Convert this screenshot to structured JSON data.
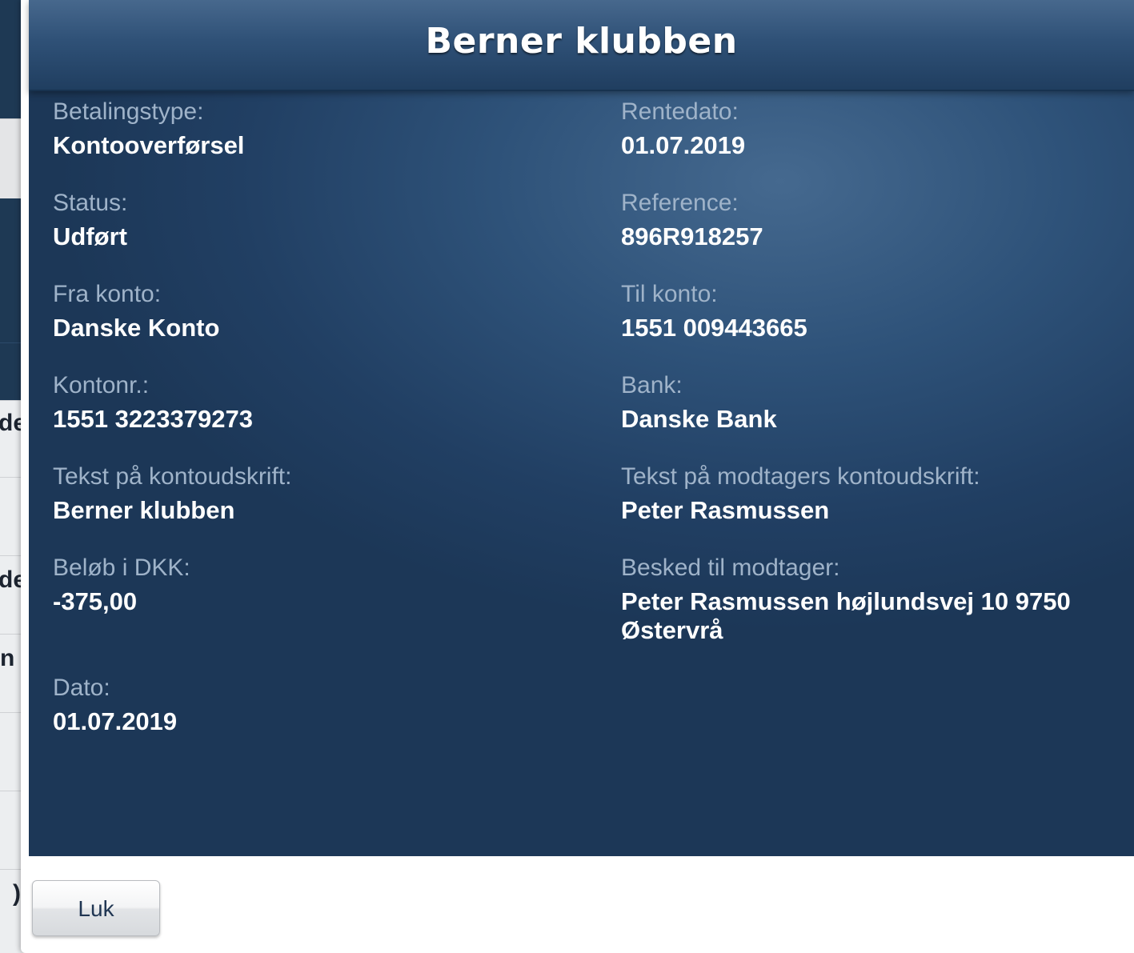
{
  "background": {
    "fragments": [
      "de",
      "de",
      "n",
      ")"
    ]
  },
  "modal": {
    "title": "Berner klubben",
    "left_fields": [
      {
        "label": "Betalingstype:",
        "value": "Kontooverførsel"
      },
      {
        "label": "Status:",
        "value": "Udført"
      },
      {
        "label": "Fra konto:",
        "value": "Danske Konto"
      },
      {
        "label": "Kontonr.:",
        "value": "1551 3223379273"
      },
      {
        "label": "Tekst på kontoudskrift:",
        "value": "Berner klubben"
      },
      {
        "label": "Beløb i DKK:",
        "value": "-375,00"
      },
      {
        "label": "Dato:",
        "value": "01.07.2019"
      }
    ],
    "right_fields": [
      {
        "label": "Rentedato:",
        "value": "01.07.2019"
      },
      {
        "label": "Reference:",
        "value": "896R918257"
      },
      {
        "label": "Til konto:",
        "value": "1551 009443665"
      },
      {
        "label": "Bank:",
        "value": "Danske Bank"
      },
      {
        "label": "Tekst på modtagers kontoudskrift:",
        "value": "Peter Rasmussen"
      },
      {
        "label": "Besked til modtager:",
        "value": "Peter Rasmussen højlundsvej 10 9750\n Østervrå"
      }
    ],
    "close_label": "Luk"
  },
  "colors": {
    "header_top": "#47688d",
    "header_bottom": "#203e60",
    "body_blue": "#2e5279",
    "label_text": "#9fb3c9",
    "value_text": "#ffffff",
    "button_text": "#1f3552"
  }
}
